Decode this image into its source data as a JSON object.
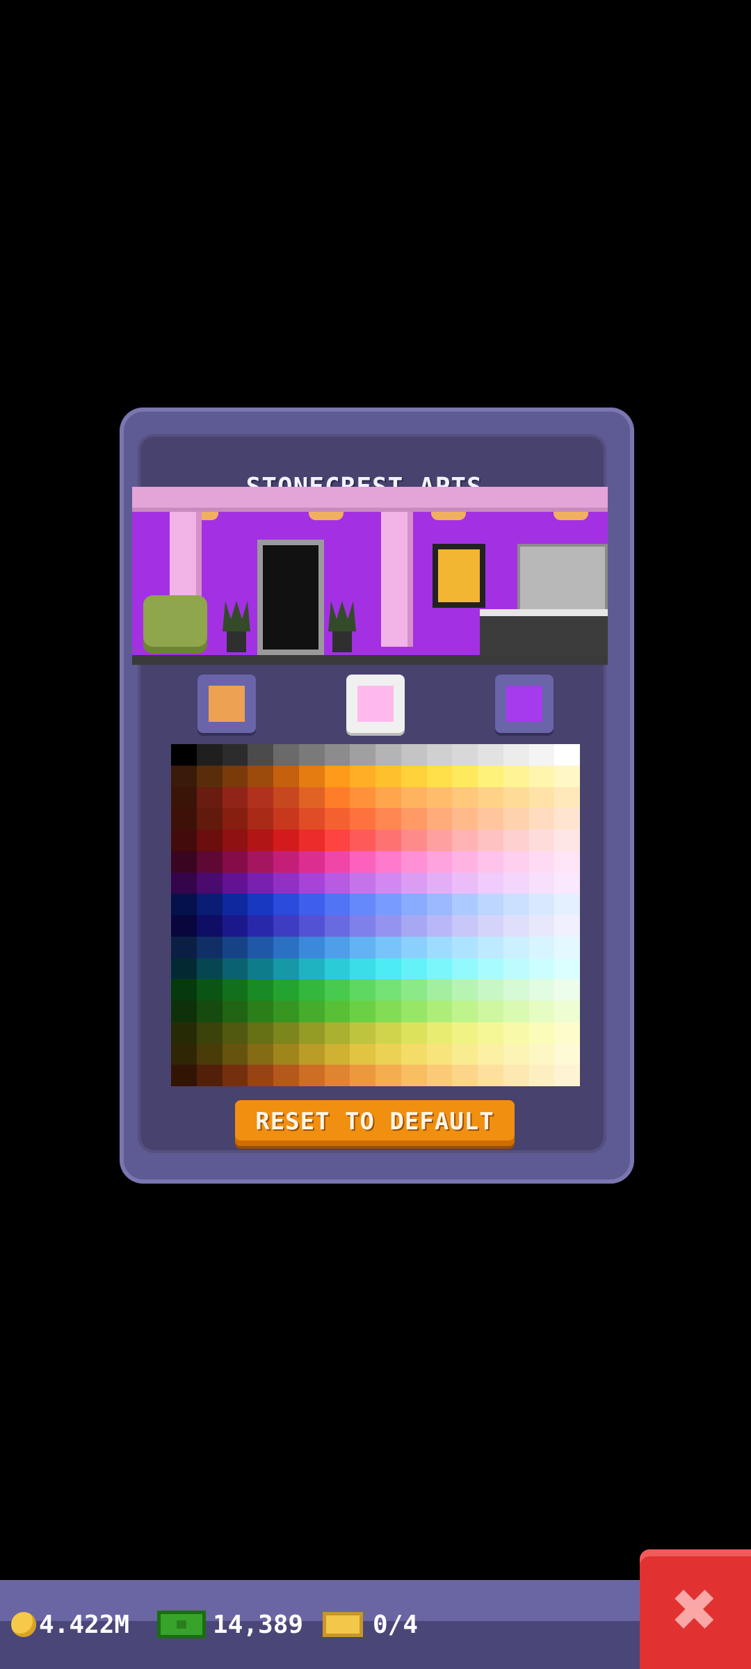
{
  "dialog": {
    "title": "STONECREST APTS.",
    "swatches": [
      {
        "color": "#EDA152",
        "selected": false
      },
      {
        "color": "#FFB9ED",
        "selected": true
      },
      {
        "color": "#A63BEE",
        "selected": false
      }
    ],
    "reset_label": "RESET TO DEFAULT"
  },
  "palette": {
    "rows": [
      [
        "#000000",
        "#1f1f1f",
        "#2c2c2c",
        "#4b4b4b",
        "#6a6a6a",
        "#7a7a7a",
        "#8c8c8c",
        "#a0a0a0",
        "#b4b4b4",
        "#c4c4c4",
        "#d0d0d0",
        "#d8d8d8",
        "#e2e2e2",
        "#ececec",
        "#f4f4f4",
        "#ffffff"
      ],
      [
        "#3a1a08",
        "#5a2d0a",
        "#7a3a0a",
        "#9d4a0d",
        "#c4600e",
        "#e57c12",
        "#ff9a1a",
        "#ffae25",
        "#ffc02e",
        "#ffd13a",
        "#ffdf4a",
        "#ffea5e",
        "#fff27a",
        "#fff394",
        "#fff5ad",
        "#fff7c6"
      ],
      [
        "#3b1408",
        "#6a1c10",
        "#912418",
        "#b0321c",
        "#c7471f",
        "#e06324",
        "#ff7d29",
        "#ff913a",
        "#ffa54c",
        "#ffb35e",
        "#ffbd6b",
        "#ffc87a",
        "#ffd288",
        "#ffdb98",
        "#ffe2a8",
        "#ffe9bb"
      ],
      [
        "#3e1108",
        "#611a0c",
        "#861f10",
        "#a82a17",
        "#c8381d",
        "#e04c26",
        "#f56031",
        "#ff723e",
        "#ff8752",
        "#ff9a66",
        "#ffab7a",
        "#ffb98b",
        "#ffc69d",
        "#ffd2ae",
        "#ffdcc0",
        "#ffe5d0"
      ],
      [
        "#430b0b",
        "#6c0e0e",
        "#8f1111",
        "#b21515",
        "#d41b1b",
        "#ec2b2b",
        "#ff4242",
        "#ff5a5a",
        "#ff7272",
        "#ff8a8a",
        "#ffa0a0",
        "#ffb3b3",
        "#ffc2c2",
        "#ffd0d0",
        "#ffdcdc",
        "#ffe6e6"
      ],
      [
        "#3a0520",
        "#5e0833",
        "#850c48",
        "#a51660",
        "#c41f78",
        "#dc2d90",
        "#ef46a8",
        "#fb61bd",
        "#ff7acc",
        "#ff90d6",
        "#ffa3de",
        "#ffb3e4",
        "#ffc2ea",
        "#ffcfef",
        "#ffdbf3",
        "#ffe5f6"
      ],
      [
        "#34054a",
        "#4b0a6e",
        "#631294",
        "#7a20b0",
        "#9230c6",
        "#a743d6",
        "#b85ae2",
        "#c672ea",
        "#d288f0",
        "#dc9cf4",
        "#e4aef7",
        "#eabdf9",
        "#f0cbfb",
        "#f4d6fc",
        "#f8e0fd",
        "#fae8fe"
      ],
      [
        "#05114a",
        "#0a1c74",
        "#0f289e",
        "#1838c2",
        "#2a4bdc",
        "#3d5fec",
        "#5174f6",
        "#6588fb",
        "#789bff",
        "#8aabff",
        "#9cb9ff",
        "#accaff",
        "#bcd6ff",
        "#cbe0ff",
        "#d8e9ff",
        "#e4f0ff"
      ],
      [
        "#08063d",
        "#0f0d66",
        "#1b188c",
        "#2a28aa",
        "#3e3cc2",
        "#5352d4",
        "#6a6ae0",
        "#8080ea",
        "#9494f0",
        "#a7a7f4",
        "#b8b8f7",
        "#c7c7f9",
        "#d4d4fb",
        "#dfdffc",
        "#e8e8fd",
        "#f0f0fe"
      ],
      [
        "#0b1f44",
        "#102f66",
        "#164386",
        "#1f58a6",
        "#2c70c4",
        "#3c88da",
        "#4f9eea",
        "#63b2f4",
        "#77c3fa",
        "#8bd0fd",
        "#9ddbff",
        "#aee3ff",
        "#bdeaff",
        "#cbf0ff",
        "#d8f4ff",
        "#e4f8ff"
      ],
      [
        "#032a33",
        "#064652",
        "#0a6170",
        "#0f7c8c",
        "#1698a8",
        "#1fb3c2",
        "#2bcbd8",
        "#3adde8",
        "#4debf3",
        "#64f2f8",
        "#7bf6fb",
        "#92f9fd",
        "#a8fbfe",
        "#bcfcfe",
        "#ccfdff",
        "#dbfeff"
      ],
      [
        "#063a0c",
        "#0b5514",
        "#11701c",
        "#198b25",
        "#24a330",
        "#33b83d",
        "#47ca4d",
        "#5ed860",
        "#75e275",
        "#8ce98a",
        "#a2ef9f",
        "#b6f4b3",
        "#c7f7c5",
        "#d6fad4",
        "#e2fce1",
        "#ecfdeb"
      ],
      [
        "#0e3109",
        "#174a0e",
        "#216414",
        "#2b7e1a",
        "#379622",
        "#45ac2c",
        "#57c037",
        "#6cd044",
        "#82dc54",
        "#98e666",
        "#adee79",
        "#bff38c",
        "#cef79f",
        "#dbfab1",
        "#e6fcc2",
        "#eefdd2"
      ],
      [
        "#262b06",
        "#3b420a",
        "#50590f",
        "#667015",
        "#7d861c",
        "#949c25",
        "#aab130",
        "#bec43d",
        "#cfd44c",
        "#dde25d",
        "#e8ec70",
        "#f0f383",
        "#f5f796",
        "#f8faa8",
        "#fbfcba",
        "#fdfdcb"
      ],
      [
        "#2f2605",
        "#4a3c09",
        "#66540e",
        "#836c14",
        "#a0851c",
        "#b99d26",
        "#cfb233",
        "#e0c442",
        "#ecd254",
        "#f3dd68",
        "#f7e57c",
        "#f9eb90",
        "#fbf0a3",
        "#fcf4b5",
        "#fdf7c6",
        "#fefad6"
      ],
      [
        "#321405",
        "#521f09",
        "#74300e",
        "#974314",
        "#b5581b",
        "#cd6e24",
        "#df8430",
        "#ec993e",
        "#f4ad4f",
        "#f9bd62",
        "#fbca76",
        "#fcd58a",
        "#fde09e",
        "#fde8b1",
        "#feefc3",
        "#fef4d3"
      ]
    ]
  },
  "bottom_bar": {
    "coins": "4.422M",
    "bux": "14,389",
    "tickets": "0/4"
  }
}
